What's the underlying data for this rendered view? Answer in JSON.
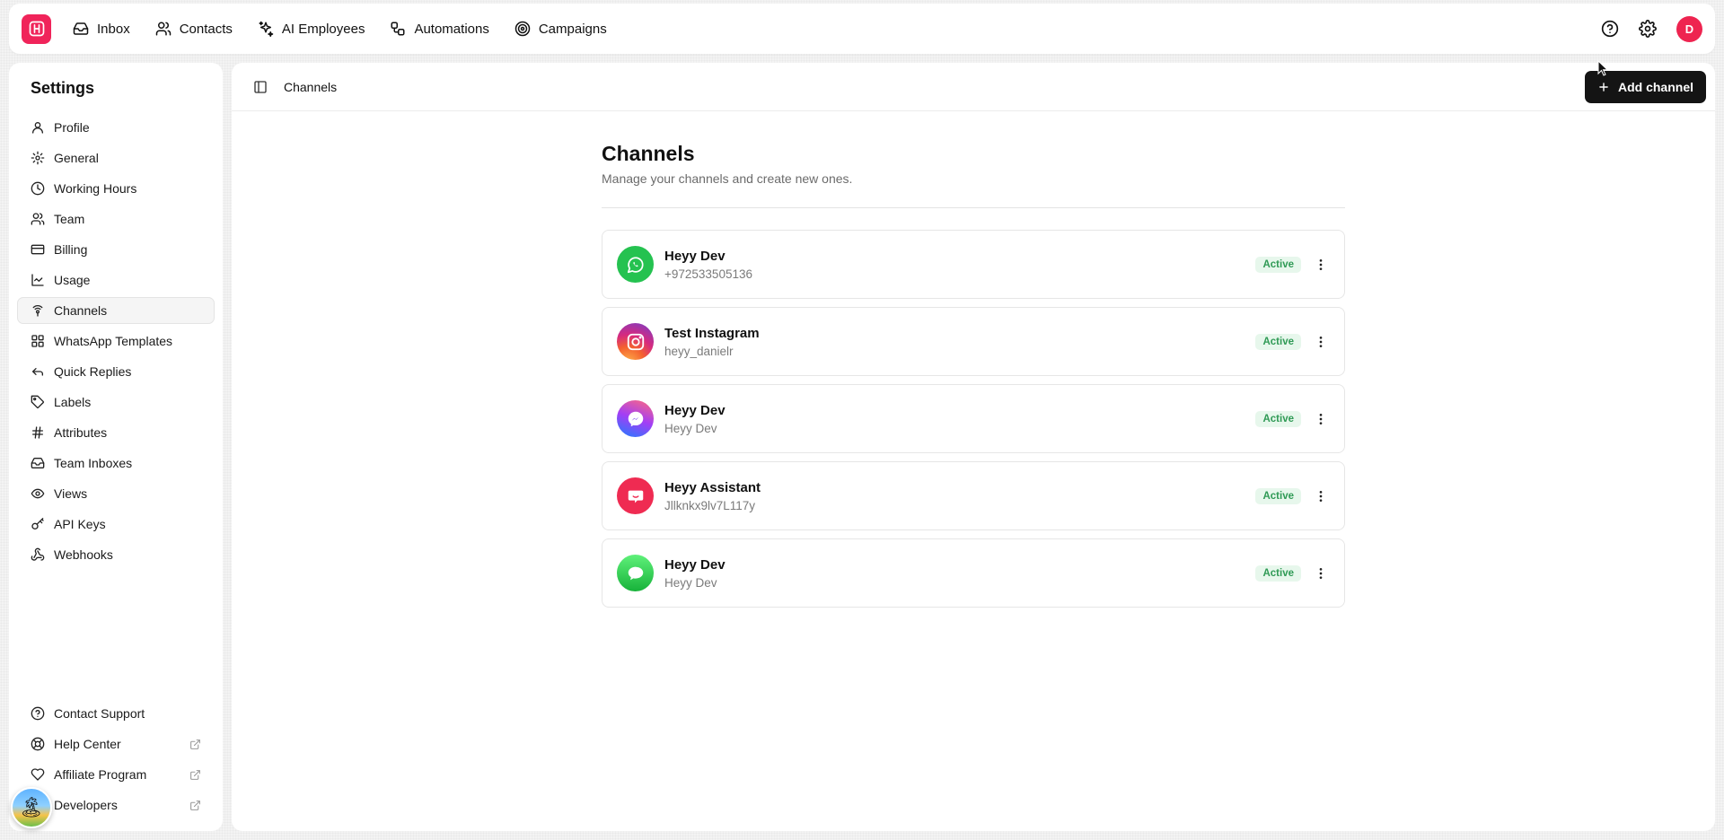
{
  "topnav": {
    "items": [
      {
        "label": "Inbox",
        "icon": "inbox-icon"
      },
      {
        "label": "Contacts",
        "icon": "contacts-icon"
      },
      {
        "label": "AI Employees",
        "icon": "sparkles-icon"
      },
      {
        "label": "Automations",
        "icon": "workflow-icon"
      },
      {
        "label": "Campaigns",
        "icon": "target-icon"
      }
    ],
    "avatar_initial": "D"
  },
  "sidebar": {
    "title": "Settings",
    "items": [
      {
        "label": "Profile",
        "icon": "user-icon"
      },
      {
        "label": "General",
        "icon": "gear-icon"
      },
      {
        "label": "Working Hours",
        "icon": "clock-icon"
      },
      {
        "label": "Team",
        "icon": "team-icon"
      },
      {
        "label": "Billing",
        "icon": "credit-card-icon"
      },
      {
        "label": "Usage",
        "icon": "chart-icon"
      },
      {
        "label": "Channels",
        "icon": "signal-icon",
        "active": true
      },
      {
        "label": "WhatsApp Templates",
        "icon": "template-icon"
      },
      {
        "label": "Quick Replies",
        "icon": "reply-icon"
      },
      {
        "label": "Labels",
        "icon": "tag-icon"
      },
      {
        "label": "Attributes",
        "icon": "hash-icon"
      },
      {
        "label": "Team Inboxes",
        "icon": "inbox-icon"
      },
      {
        "label": "Views",
        "icon": "eye-icon"
      },
      {
        "label": "API Keys",
        "icon": "key-icon"
      },
      {
        "label": "Webhooks",
        "icon": "webhook-icon"
      }
    ],
    "bottom_items": [
      {
        "label": "Contact Support",
        "icon": "help-circle-icon"
      },
      {
        "label": "Help Center",
        "icon": "lifebuoy-icon"
      },
      {
        "label": "Affiliate Program",
        "icon": "heart-handshake-icon"
      },
      {
        "label": "Developers",
        "icon": "code-icon"
      }
    ]
  },
  "main": {
    "breadcrumb": "Channels",
    "add_button_label": "Add channel",
    "title": "Channels",
    "subtitle": "Manage your channels and create new ones.",
    "channels": [
      {
        "name": "Heyy Dev",
        "detail": "+972533505136",
        "status": "Active",
        "type": "whatsapp"
      },
      {
        "name": "Test Instagram",
        "detail": "heyy_danielr",
        "status": "Active",
        "type": "instagram"
      },
      {
        "name": "Heyy Dev",
        "detail": "Heyy Dev",
        "status": "Active",
        "type": "messenger"
      },
      {
        "name": "Heyy Assistant",
        "detail": "Jllknkx9lv7L117y",
        "status": "Active",
        "type": "assistant"
      },
      {
        "name": "Heyy Dev",
        "detail": "Heyy Dev",
        "status": "Active",
        "type": "imessage"
      }
    ]
  },
  "colors": {
    "brand": "#f0245a",
    "active_badge_bg": "#e7f7ec",
    "active_badge_text": "#2f9a55",
    "button_dark": "#141414"
  }
}
